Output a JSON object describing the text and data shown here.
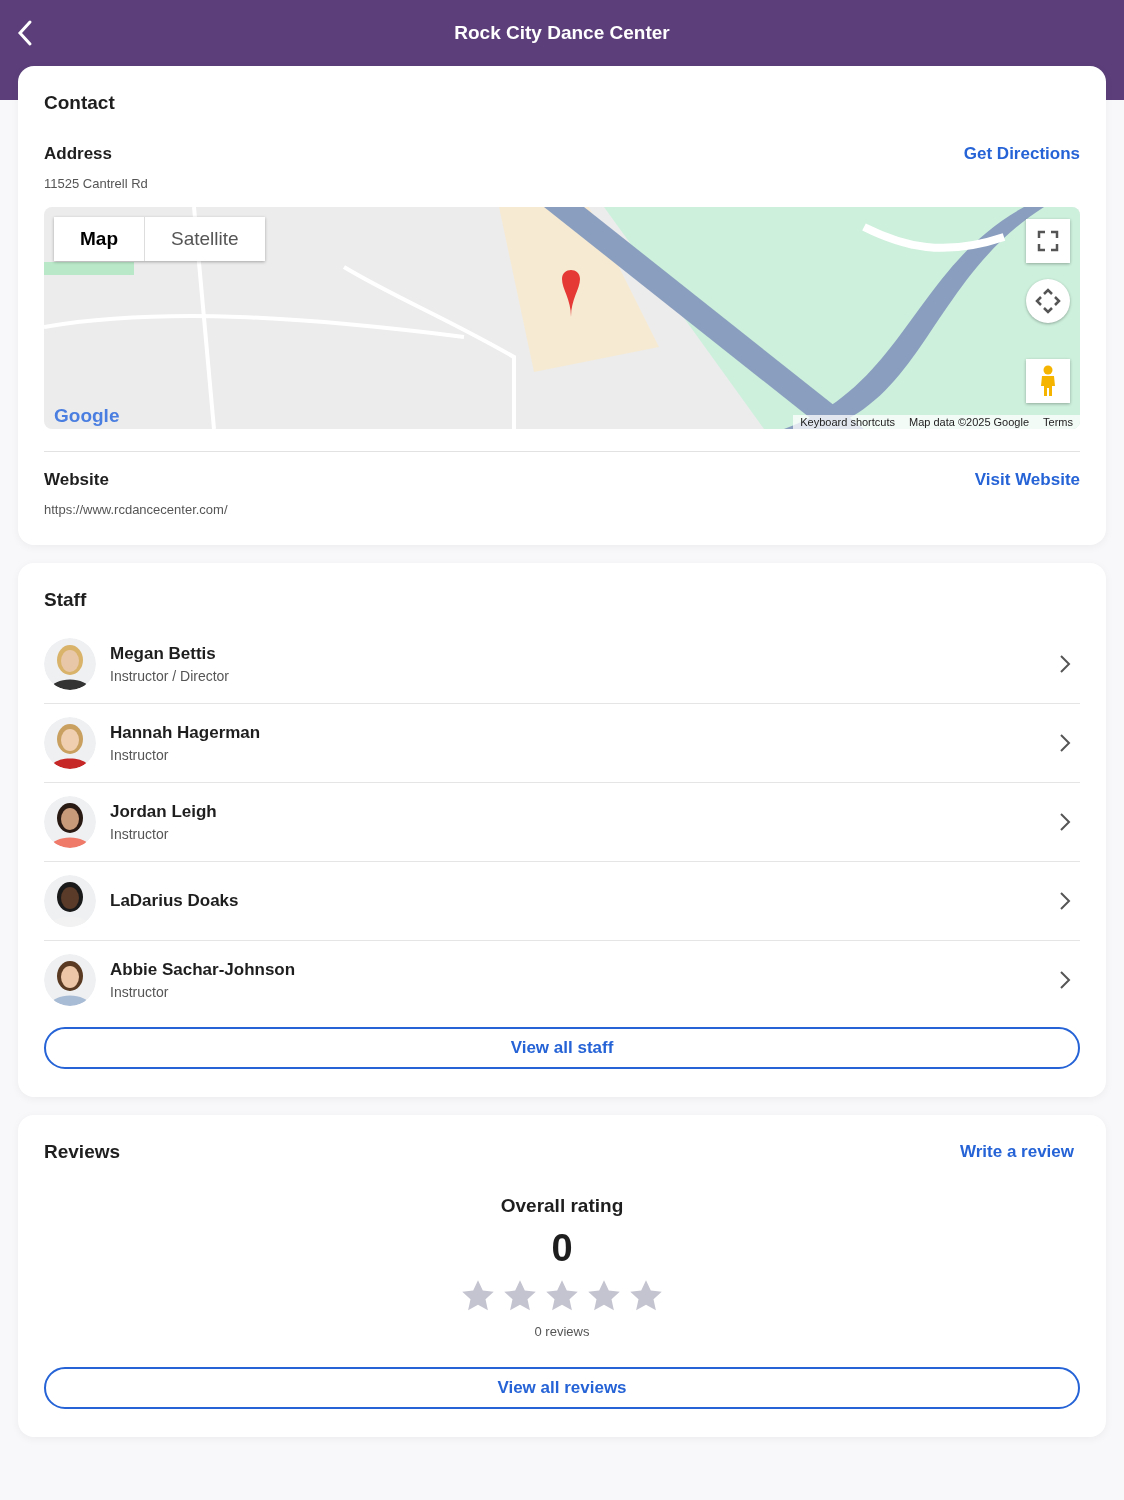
{
  "header": {
    "title": "Rock City Dance Center"
  },
  "contact": {
    "title": "Contact",
    "address_label": "Address",
    "directions_link": "Get Directions",
    "address": "11525 Cantrell Rd",
    "map": {
      "kind": "picture",
      "map_types": [
        {
          "label": "Map",
          "selected": true
        },
        {
          "label": "Satellite",
          "selected": false
        }
      ],
      "logo": "Google",
      "attribution": [
        "Keyboard shortcuts",
        "Map data ©2025 Google",
        "Terms"
      ]
    },
    "website_label": "Website",
    "website_link": "Visit Website",
    "website": "https://www.rcdancecenter.com/"
  },
  "staff": {
    "title": "Staff",
    "members": [
      {
        "name": "Megan Bettis",
        "role": "Instructor / Director"
      },
      {
        "name": "Hannah Hagerman",
        "role": "Instructor"
      },
      {
        "name": "Jordan Leigh",
        "role": "Instructor"
      },
      {
        "name": "LaDarius Doaks"
      },
      {
        "name": "Abbie Sachar-Johnson",
        "role": "Instructor"
      }
    ],
    "view_all": "View all staff"
  },
  "reviews": {
    "title": "Reviews",
    "write_link": "Write a review",
    "overall_label": "Overall rating",
    "score": "0",
    "stars": 0,
    "count": "0 reviews",
    "view_all": "View all reviews"
  }
}
